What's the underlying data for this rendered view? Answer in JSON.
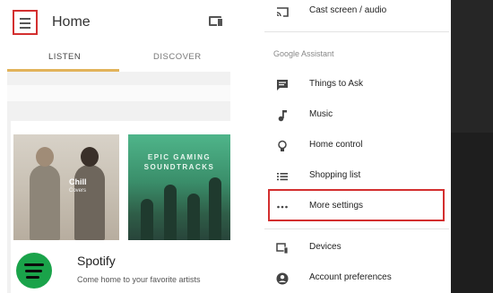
{
  "left": {
    "app_title": "Home",
    "tabs": [
      {
        "label": "LISTEN",
        "selected": true
      },
      {
        "label": "DISCOVER",
        "selected": false
      }
    ],
    "tiles": {
      "chill_title": "Chill",
      "chill_sub": "Covers",
      "epic_title": "EPIC GAMING SOUNDTRACKS"
    },
    "spotify": {
      "name": "Spotify",
      "description": "Come home to your favorite artists"
    },
    "icons": {
      "menu": "hamburger-menu-icon",
      "cast": "devices-icon"
    },
    "accent_color": "#e2b35a",
    "highlight_color": "#d32f2f"
  },
  "drawer": {
    "top_item": {
      "label": "Cast screen / audio",
      "icon": "cast-icon"
    },
    "section_title": "Google Assistant",
    "assistant_items": [
      {
        "label": "Things to Ask",
        "icon": "chat-icon"
      },
      {
        "label": "Music",
        "icon": "music-note-icon"
      },
      {
        "label": "Home control",
        "icon": "lightbulb-icon"
      },
      {
        "label": "Shopping list",
        "icon": "list-icon"
      },
      {
        "label": "More settings",
        "icon": "more-horizontal-icon",
        "highlighted": true
      }
    ],
    "bottom_items": [
      {
        "label": "Devices",
        "icon": "devices-icon"
      },
      {
        "label": "Account preferences",
        "icon": "account-circle-icon"
      }
    ]
  }
}
